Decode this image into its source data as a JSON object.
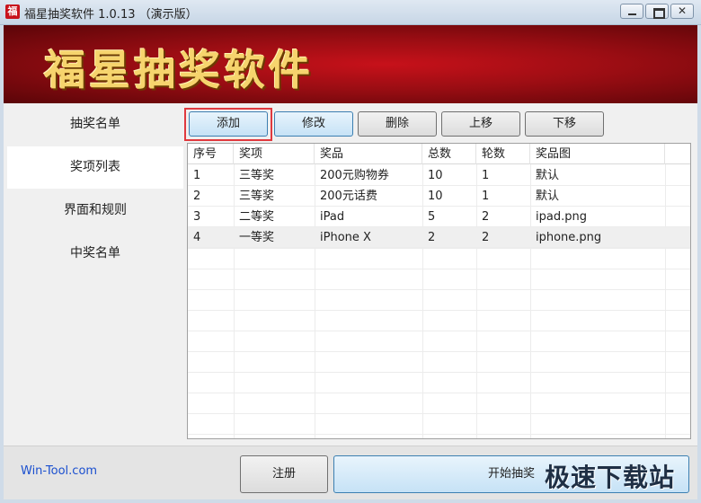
{
  "window": {
    "app_icon": "福",
    "title": "福星抽奖软件 1.0.13 （演示版）",
    "close_glyph": "✕"
  },
  "banner": {
    "title": "福星抽奖软件"
  },
  "sidebar": {
    "items": [
      {
        "label": "抽奖名单"
      },
      {
        "label": "奖项列表"
      },
      {
        "label": "界面和规则"
      },
      {
        "label": "中奖名单"
      }
    ],
    "active_index": 1
  },
  "toolbar": {
    "add_label": "添加",
    "edit_label": "修改",
    "delete_label": "删除",
    "move_up_label": "上移",
    "move_down_label": "下移"
  },
  "table": {
    "columns": [
      "序号",
      "奖项",
      "奖品",
      "总数",
      "轮数",
      "奖品图"
    ],
    "rows": [
      [
        "1",
        "三等奖",
        "200元购物券",
        "10",
        "1",
        "默认"
      ],
      [
        "2",
        "三等奖",
        "200元话费",
        "10",
        "1",
        "默认"
      ],
      [
        "3",
        "二等奖",
        "iPad",
        "5",
        "2",
        "ipad.png"
      ],
      [
        "4",
        "一等奖",
        "iPhone X",
        "2",
        "2",
        "iphone.png"
      ]
    ],
    "selected_row": 3
  },
  "footer": {
    "link": "Win-Tool.com",
    "register_label": "注册",
    "start_label": "开始抽奖",
    "watermark": "极速下载站"
  },
  "colors": {
    "banner_red": "#9a0d13",
    "banner_text": "#f6d46d",
    "highlight": "#e0393e",
    "link": "#1a4fcf"
  }
}
